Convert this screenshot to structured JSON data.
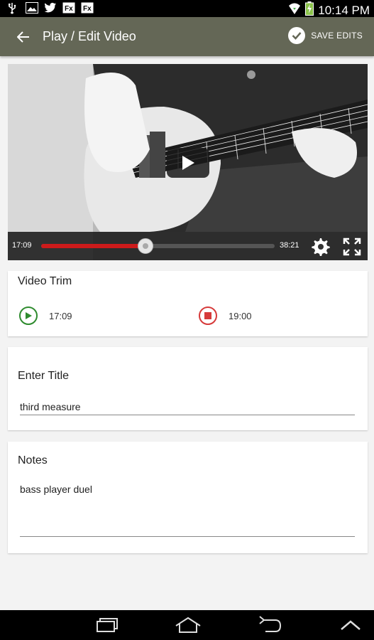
{
  "status_bar": {
    "time": "10:14 PM",
    "left_icons": [
      "usb-icon",
      "image-icon",
      "twitter-icon",
      "fx-icon",
      "fx-icon"
    ],
    "right_icons": [
      "wifi-icon",
      "battery-charging-icon"
    ]
  },
  "app_bar": {
    "title": "Play / Edit Video",
    "save_label": "SAVE EDITS",
    "background": "#646756"
  },
  "video": {
    "current_time": "17:09",
    "duration": "38:21",
    "progress_fraction": 0.447,
    "played_color": "#cc1b1b"
  },
  "video_trim": {
    "title": "Video Trim",
    "start_time": "17:09",
    "end_time": "19:00",
    "start_color": "#2e8b2e",
    "end_color": "#d63a3a"
  },
  "title_section": {
    "label": "Enter Title",
    "value": "third measure"
  },
  "notes_section": {
    "label": "Notes",
    "value": "bass player duel"
  },
  "nav_bar": {
    "buttons": [
      "recent-apps-icon",
      "home-icon",
      "back-icon",
      "menu-up-icon"
    ]
  }
}
